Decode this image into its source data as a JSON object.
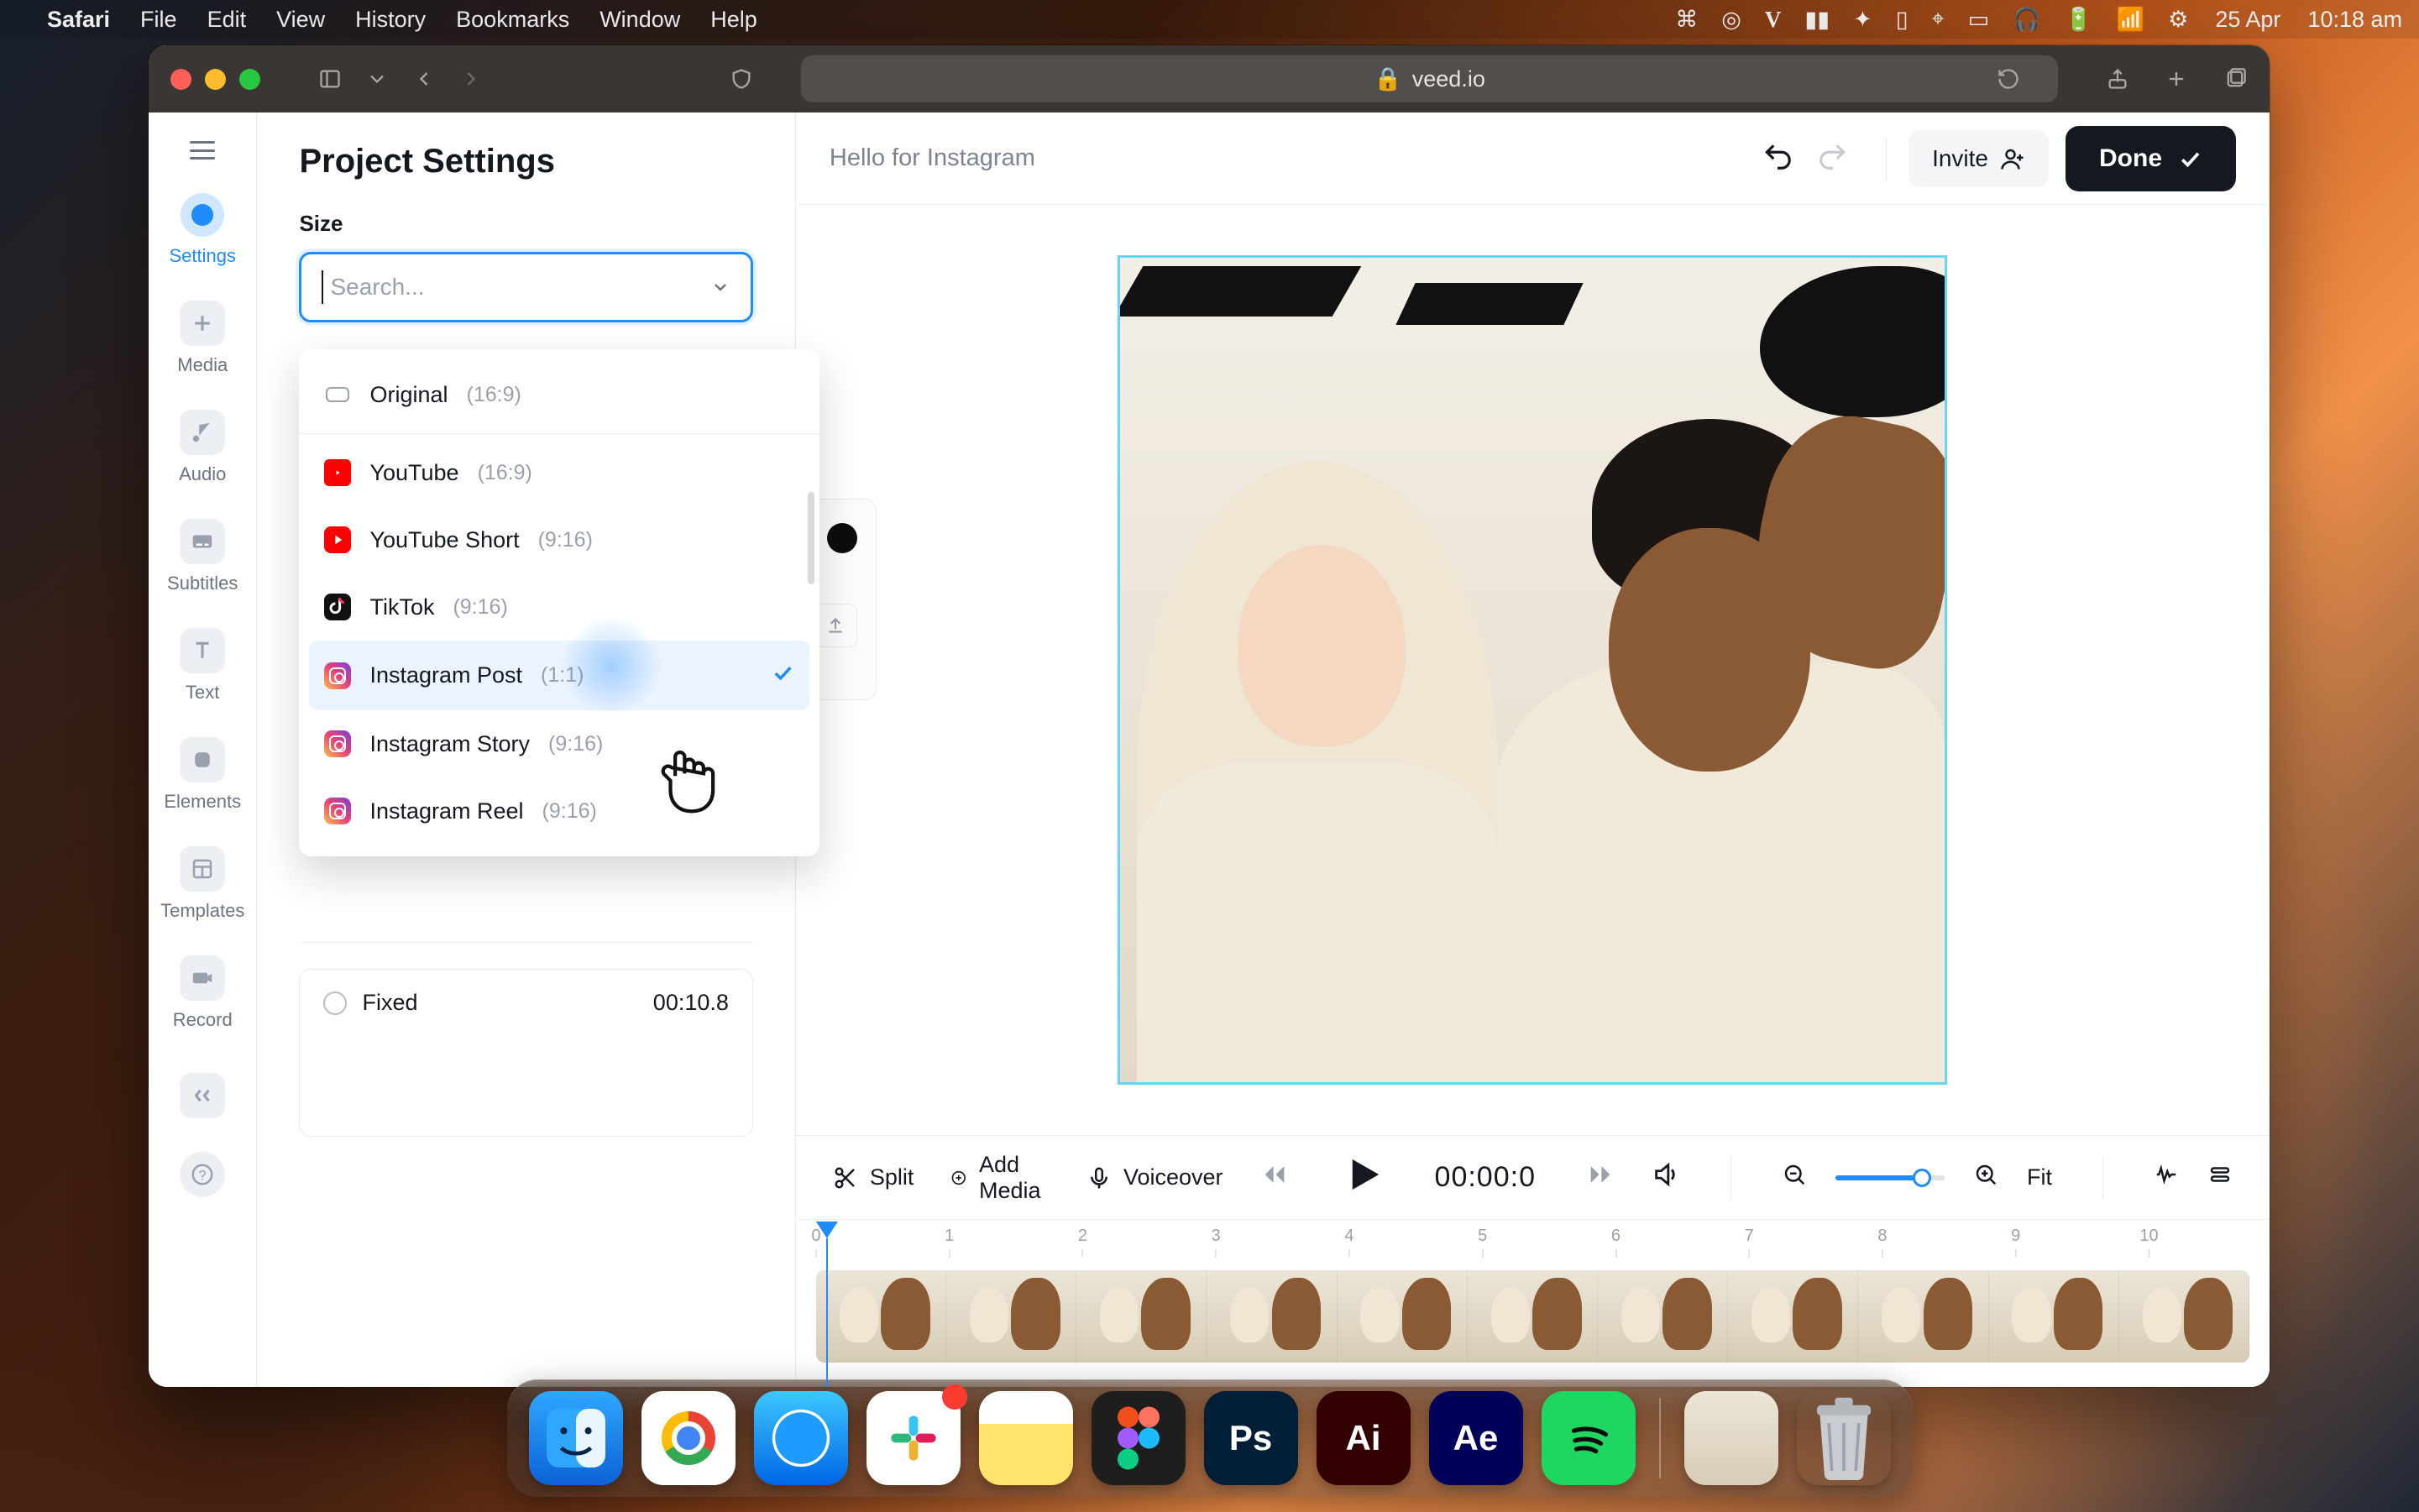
{
  "menubar": {
    "app_name": "Safari",
    "items": [
      "File",
      "Edit",
      "View",
      "History",
      "Bookmarks",
      "Window",
      "Help"
    ],
    "date": "25 Apr",
    "time": "10:18 am"
  },
  "browser": {
    "url_host": "veed.io"
  },
  "rail": {
    "items": [
      {
        "label": "Settings",
        "icon": "settings-ring",
        "active": true
      },
      {
        "label": "Media",
        "icon": "plus"
      },
      {
        "label": "Audio",
        "icon": "music-note"
      },
      {
        "label": "Subtitles",
        "icon": "subtitles"
      },
      {
        "label": "Text",
        "icon": "text"
      },
      {
        "label": "Elements",
        "icon": "elements"
      },
      {
        "label": "Templates",
        "icon": "templates"
      },
      {
        "label": "Record",
        "icon": "record"
      }
    ]
  },
  "panel": {
    "title": "Project Settings",
    "size_label": "Size",
    "search_placeholder": "Search..."
  },
  "size_dropdown": {
    "options": [
      {
        "label": "Original",
        "ratio": "(16:9)",
        "icon": "original"
      },
      {
        "label": "YouTube",
        "ratio": "(16:9)",
        "icon": "youtube"
      },
      {
        "label": "YouTube Short",
        "ratio": "(9:16)",
        "icon": "youtube-short"
      },
      {
        "label": "TikTok",
        "ratio": "(9:16)",
        "icon": "tiktok"
      },
      {
        "label": "Instagram Post",
        "ratio": "(1:1)",
        "icon": "instagram",
        "selected": true
      },
      {
        "label": "Instagram Story",
        "ratio": "(9:16)",
        "icon": "instagram"
      },
      {
        "label": "Instagram Reel",
        "ratio": "(9:16)",
        "icon": "instagram"
      }
    ]
  },
  "duration_card": {
    "mode_label": "Fixed",
    "duration": "00:10.8"
  },
  "topbar": {
    "project_name": "Hello for Instagram",
    "invite_label": "Invite",
    "done_label": "Done"
  },
  "transport": {
    "split_label": "Split",
    "add_media_label": "Add Media",
    "voiceover_label": "Voiceover",
    "timecode": "00:00:0",
    "fit_label": "Fit"
  },
  "timeline": {
    "ticks": [
      "0",
      "1",
      "2",
      "3",
      "4",
      "5",
      "6",
      "7",
      "8",
      "9",
      "10"
    ]
  },
  "dock": {
    "apps": [
      "Finder",
      "Chrome",
      "Safari",
      "Slack",
      "Notes",
      "Figma",
      "Photoshop",
      "Illustrator",
      "After Effects",
      "Spotify"
    ],
    "ps": "Ps",
    "ai": "Ai",
    "ae": "Ae"
  }
}
